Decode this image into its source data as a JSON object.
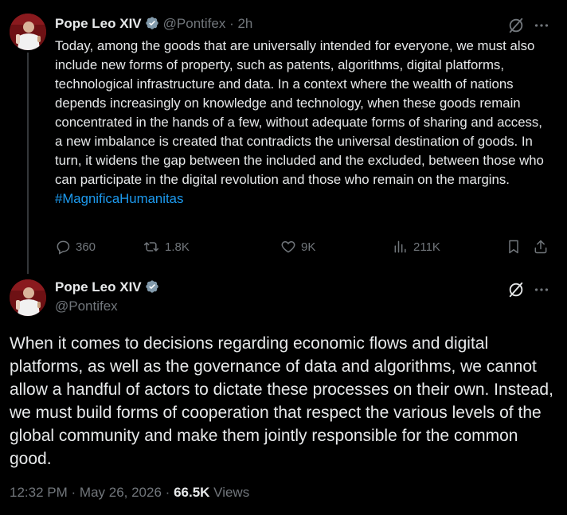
{
  "post1": {
    "author_name": "Pope Leo XIV",
    "handle": "@Pontifex",
    "separator": "·",
    "time_ago": "2h",
    "text": "Today, among the goods that are universally intended for everyone, we must also include new forms of property, such as patents, algorithms, digital platforms, technological infrastructure and data. In a context where the wealth of nations depends increasingly on knowledge and technology, when these goods remain concentrated in the hands of a few, without adequate forms of sharing and access, a new imbalance is created that contradicts the universal destination of goods. In turn, it widens the gap between the included and the excluded, between those who can participate in the digital revolution and those who remain on the margins.",
    "hashtag": "#MagnificaHumanitas",
    "replies": "360",
    "reposts": "1.8K",
    "likes": "9K",
    "views": "211K"
  },
  "post2": {
    "author_name": "Pope Leo XIV",
    "handle": "@Pontifex",
    "text": "When it comes to decisions regarding economic flows and digital platforms, as well as the governance of data and algorithms, we cannot allow a handful of actors to dictate these processes on their own. Instead, we must build forms of cooperation that respect the various levels of the global community and make them jointly responsible for the common good.",
    "time": "12:32 PM",
    "separator": "·",
    "date": "May 26, 2026",
    "separator2": "·",
    "views_count": "66.5K",
    "views_label": "Views"
  },
  "colors": {
    "background": "#000000",
    "text": "#e7e9ea",
    "muted": "#71767b",
    "link": "#1d9bf0",
    "verified": "#829aab"
  },
  "icons": [
    "verified-badge-icon",
    "grok-icon",
    "more-icon",
    "reply-icon",
    "repost-icon",
    "like-icon",
    "views-icon",
    "bookmark-icon",
    "share-icon"
  ]
}
